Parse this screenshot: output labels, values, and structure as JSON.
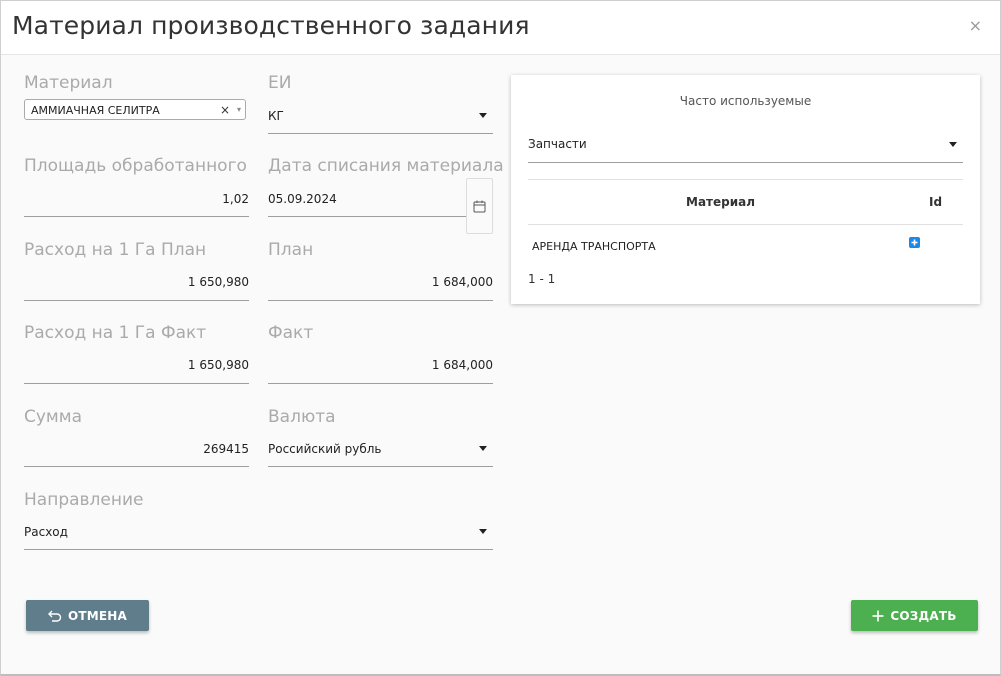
{
  "dialog": {
    "title": "Материал производственного задания",
    "close_glyph": "×"
  },
  "form": {
    "material": {
      "label": "Материал",
      "value": "АММИАЧНАЯ СЕЛИТРА",
      "clear_glyph": "×",
      "dropdown_glyph": "▾"
    },
    "unit": {
      "label": "ЕИ",
      "value": "КГ"
    },
    "area": {
      "label": "Площадь обработанного",
      "value": "1,02"
    },
    "writeoff_date": {
      "label": "Дата списания материала",
      "value": "05.09.2024"
    },
    "rate_plan": {
      "label": "Расход на 1 Га План",
      "value": "1 650,980"
    },
    "plan": {
      "label": "План",
      "value": "1 684,000"
    },
    "rate_fact": {
      "label": "Расход на 1 Га Факт",
      "value": "1 650,980"
    },
    "fact": {
      "label": "Факт",
      "value": "1 684,000"
    },
    "sum": {
      "label": "Сумма",
      "value": "269415"
    },
    "currency": {
      "label": "Валюта",
      "value": "Российский рубль"
    },
    "direction": {
      "label": "Направление",
      "value": "Расход"
    }
  },
  "frequent": {
    "title": "Часто используемые",
    "category": "Запчасти",
    "columns": [
      "Материал",
      "Id"
    ],
    "rows": [
      {
        "material": "АРЕНДА ТРАНСПОРТА",
        "action_icon": "plus-square-icon"
      }
    ],
    "pager": "1 - 1"
  },
  "buttons": {
    "cancel_label": "ОТМЕНА",
    "create_label": "СОЗДАТЬ"
  },
  "colors": {
    "cancel": "#607d8b",
    "create": "#4caf50",
    "accent": "#1e88e5"
  }
}
